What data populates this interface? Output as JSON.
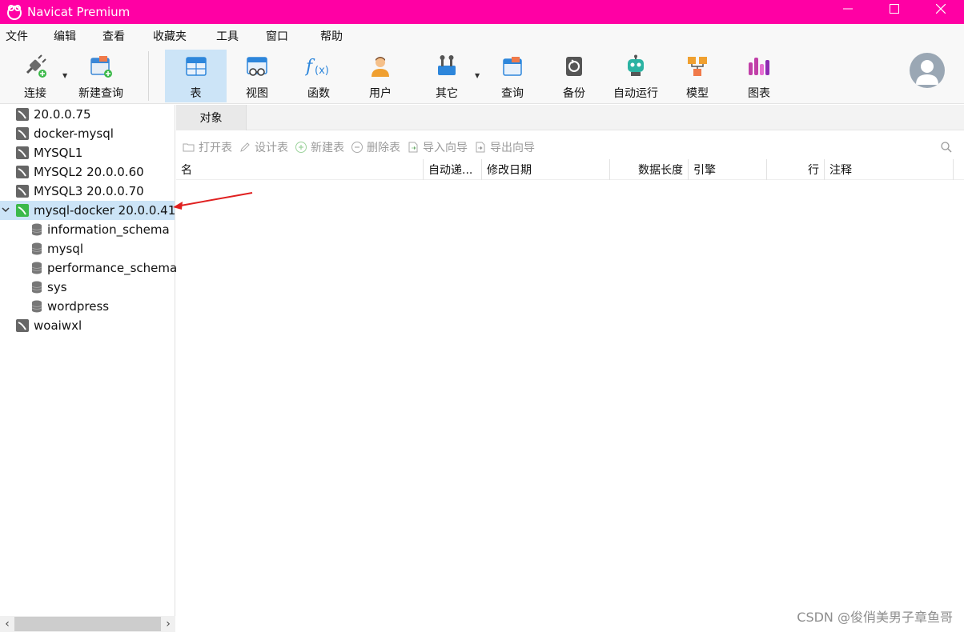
{
  "app": {
    "title": "Navicat Premium"
  },
  "menu": [
    "文件",
    "编辑",
    "查看",
    "收藏夹",
    "工具",
    "窗口",
    "帮助"
  ],
  "toolbar": {
    "connect": "连接",
    "new_query": "新建查询",
    "table": "表",
    "view": "视图",
    "function": "函数",
    "user": "用户",
    "other": "其它",
    "query": "查询",
    "backup": "备份",
    "automation": "自动运行",
    "model": "模型",
    "chart": "图表"
  },
  "sidebar": {
    "items": [
      {
        "label": "20.0.0.75"
      },
      {
        "label": "docker-mysql"
      },
      {
        "label": "MYSQL1"
      },
      {
        "label": "MYSQL2  20.0.0.60"
      },
      {
        "label": "MYSQL3  20.0.0.70"
      },
      {
        "label": "mysql-docker 20.0.0.41",
        "selected": true,
        "expanded": true
      },
      {
        "label": "information_schema"
      },
      {
        "label": "mysql"
      },
      {
        "label": "performance_schema"
      },
      {
        "label": "sys"
      },
      {
        "label": "wordpress"
      },
      {
        "label": "woaiwxl"
      }
    ]
  },
  "main": {
    "tab": "对象",
    "actions": {
      "open_table": "打开表",
      "design_table": "设计表",
      "new_table": "新建表",
      "delete_table": "删除表",
      "import_wizard": "导入向导",
      "export_wizard": "导出向导"
    },
    "columns": {
      "name": "名",
      "auto_increment": "自动递...",
      "modified": "修改日期",
      "data_length": "数据长度",
      "engine": "引擎",
      "rows": "行",
      "comment": "注释"
    }
  },
  "watermark": "CSDN @俊俏美男子章鱼哥",
  "colors": {
    "titlebar": "#ff00a4",
    "selection": "#cce4f7",
    "connection_active": "#3cb94a"
  }
}
